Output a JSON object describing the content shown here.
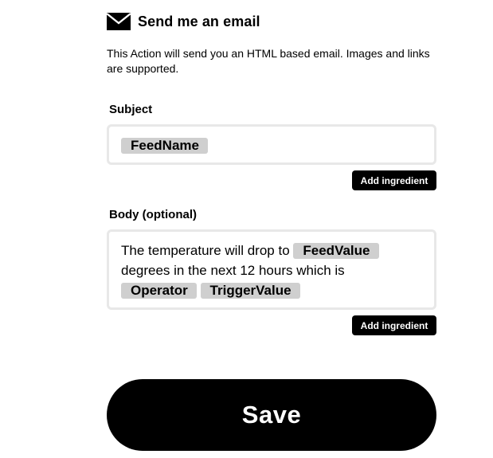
{
  "action": {
    "icon": "mail-icon",
    "title": "Send me an email",
    "description": "This Action will send you an HTML based email. Images and links are supported."
  },
  "subject": {
    "label": "Subject",
    "ingredient": "FeedName",
    "add_ingredient_label": "Add ingredient"
  },
  "body": {
    "label": "Body (optional)",
    "text_1": "The temperature will drop to",
    "ingredient_1": "FeedValue",
    "text_2": "degrees in the next 12 hours which is",
    "ingredient_2": "Operator",
    "ingredient_3": "TriggerValue",
    "add_ingredient_label": "Add ingredient"
  },
  "save_label": "Save",
  "colors": {
    "ingredient_pill": "#cfcfcf",
    "field_border": "#e8e8e8",
    "button": "#000000"
  }
}
